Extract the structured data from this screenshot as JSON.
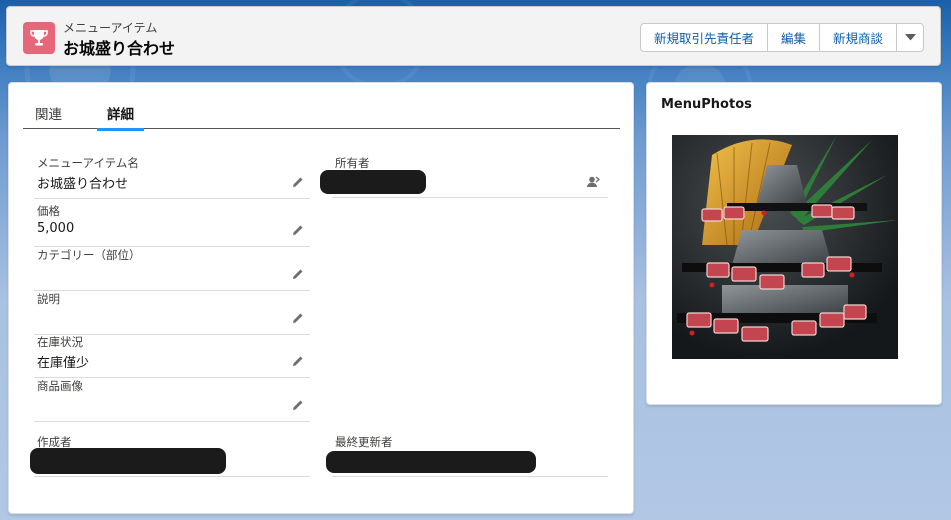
{
  "header": {
    "object_label": "メニューアイテム",
    "record_title": "お城盛り合わせ",
    "icon": "trophy-icon",
    "icon_color": "#e8667a",
    "buttons": [
      "新規取引先責任者",
      "編集",
      "新規商談"
    ],
    "menu_icon": "chevron-down-icon"
  },
  "tabs": [
    {
      "label": "関連",
      "active": false
    },
    {
      "label": "詳細",
      "active": true
    }
  ],
  "fields": {
    "menu_item_name": {
      "label": "メニューアイテム名",
      "value": "お城盛り合わせ"
    },
    "owner": {
      "label": "所有者",
      "value": ""
    },
    "price": {
      "label": "価格",
      "value": "5,000"
    },
    "category": {
      "label": "カテゴリー（部位）",
      "value": ""
    },
    "description": {
      "label": "説明",
      "value": ""
    },
    "stock_status": {
      "label": "在庫状況",
      "value": "在庫僅少"
    },
    "product_image": {
      "label": "商品画像",
      "value": ""
    },
    "created_by": {
      "label": "作成者",
      "value": ""
    },
    "last_modified_by": {
      "label": "最終更新者",
      "value": ""
    }
  },
  "side_panel": {
    "title": "MenuPhotos"
  },
  "colors": {
    "accent": "#1b96ff",
    "link": "#0b5cab"
  }
}
